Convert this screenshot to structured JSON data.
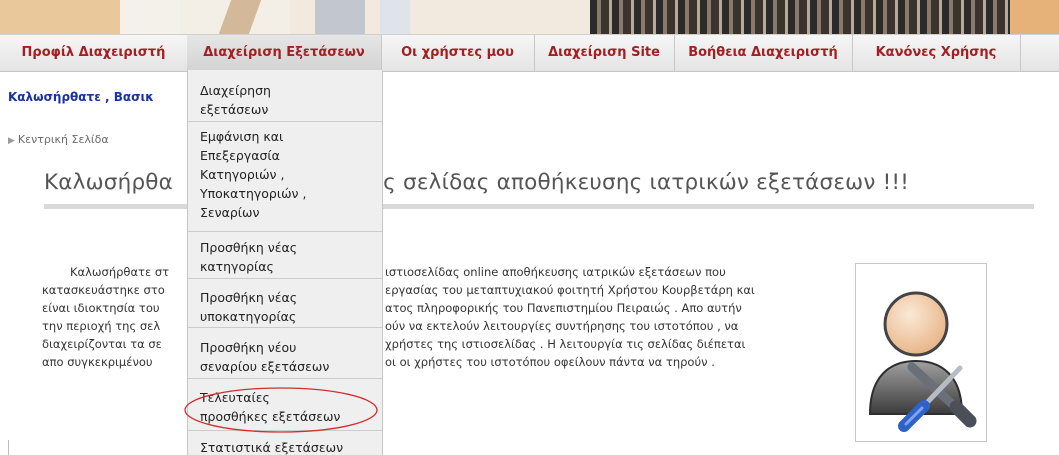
{
  "nav": {
    "items": [
      {
        "label": "Προφίλ Διαχειριστή"
      },
      {
        "label": "Διαχείριση Εξετάσεων"
      },
      {
        "label": "Οι χρήστες μου"
      },
      {
        "label": "Διαχείριση Site"
      },
      {
        "label": "Βοήθεια Διαχειριστή"
      },
      {
        "label": "Κανόνες Χρήσης"
      }
    ],
    "active_index": 1
  },
  "dropdown": {
    "items": [
      {
        "lines": [
          "Διαχείρηση",
          "εξετάσεων"
        ]
      },
      {
        "lines": [
          "Εμφάνιση και",
          "Επεξεργασία",
          "Κατηγοριών ,",
          "Υποκατηγοριών ,",
          "Σεναρίων"
        ]
      },
      {
        "lines": [
          "Προσθήκη νέας",
          "κατηγορίας"
        ]
      },
      {
        "lines": [
          "Προσθήκη νέας",
          "υποκατηγορίας"
        ]
      },
      {
        "lines": [
          "Προσθήκη νέου",
          "σεναρίου εξετάσεων"
        ]
      },
      {
        "lines": [
          "Τελευταίες",
          "προσθήκες εξετάσεων"
        ]
      },
      {
        "lines": [
          "Στατιστικά εξετάσεων"
        ]
      }
    ],
    "highlighted_index": 5
  },
  "welcome": "Καλωσήρθατε , Βασικ",
  "breadcrumb": "Κεντρική Σελίδα",
  "title_left": "Καλωσήρθα",
  "title_right": "ιση της σελίδας αποθήκευσης ιατρικών εξετάσεων !!!",
  "body": {
    "left": [
      "Καλωσήρθατε στ",
      "κατασκευάστηκε στο",
      "είναι ιδιοκτησία του",
      "την περιοχή της σελ",
      "διαχειρίζονται τα σε",
      "απο συγκεκριμένου"
    ],
    "right": [
      "ιστιοσελίδας online αποθήκευσης ιατρικών εξετάσεων που",
      "εργασίας του μεταπτυχιακού φοιτητή Χρήστου Κουρβετάρη και",
      "ατος πληροφορικής του Πανεπιστημίου Πειραιώς . Απο αυτήν",
      "ούν να εκτελούν λειτουργίες συντήρησης του ιστοτόπου , να",
      "χρήστες της ιστιοσελίδας . Η λειτουργία τις σελίδας διέπεται",
      "οι οι χρήστες του ιστοτόπου οφείλουν πάντα να τηρούν ."
    ]
  },
  "illustration": {
    "icon": "admin-user-with-tools-icon"
  },
  "colors": {
    "nav_text": "#a31f22",
    "welcome_text": "#1a33a0",
    "highlight_ellipse": "#d03030",
    "menu_bg": "#efefef"
  }
}
